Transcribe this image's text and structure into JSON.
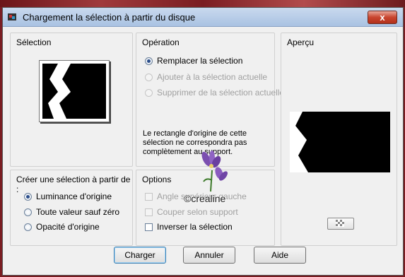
{
  "window": {
    "title": "Chargement la sélection à partir du disque",
    "close_label": "x"
  },
  "selection_panel": {
    "title": "Sélection"
  },
  "operation_panel": {
    "title": "Opération",
    "options": [
      {
        "label": "Remplacer la sélection",
        "checked": true,
        "disabled": false
      },
      {
        "label": "Ajouter à la sélection actuelle",
        "checked": false,
        "disabled": true
      },
      {
        "label": "Supprimer de la sélection actuelle",
        "checked": false,
        "disabled": true
      }
    ],
    "info": "Le rectangle d'origine de cette sélection ne correspondra pas complètement au support."
  },
  "preview_panel": {
    "title": "Aperçu"
  },
  "create_panel": {
    "title": "Créer une sélection à partir de :",
    "options": [
      {
        "label": "Luminance d'origine",
        "checked": true
      },
      {
        "label": "Toute valeur sauf zéro",
        "checked": false
      },
      {
        "label": "Opacité d'origine",
        "checked": false
      }
    ]
  },
  "options_panel": {
    "title": "Options",
    "checks": [
      {
        "label": "Angle supérieur gauche",
        "checked": false,
        "disabled": true
      },
      {
        "label": "Couper selon support",
        "checked": false,
        "disabled": true
      },
      {
        "label": "Inverser la sélection",
        "checked": false,
        "disabled": false
      }
    ]
  },
  "buttons": {
    "load": "Charger",
    "cancel": "Annuler",
    "help": "Aide"
  },
  "watermark": "©crealine",
  "icons": {
    "app": "app-icon",
    "transparency": "checkerboard-icon",
    "flower": "iris-flower-icon"
  }
}
